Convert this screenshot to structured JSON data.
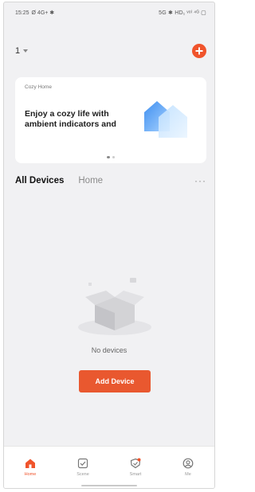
{
  "status_bar": {
    "time": "15:25",
    "left_indicators": "Ø 4G+ ✱",
    "right_indicators": "5G ✱ HD₁ ᵛᵒˡ ⁴ᴳ ▢"
  },
  "header": {
    "home_name": "1",
    "add_icon": "plus-icon"
  },
  "banner": {
    "tag": "Cozy Home",
    "headline": "Enjoy a cozy life with ambient indicators and",
    "page_count": 2,
    "active_page": 0
  },
  "tabs": [
    {
      "label": "All Devices",
      "active": true
    },
    {
      "label": "Home",
      "active": false
    }
  ],
  "more_label": "···",
  "empty_state": {
    "message": "No devices",
    "button_label": "Add Device"
  },
  "bottom_nav": [
    {
      "label": "Home",
      "icon": "home-icon",
      "active": true
    },
    {
      "label": "Scene",
      "icon": "scene-icon",
      "active": false
    },
    {
      "label": "Smart",
      "icon": "smart-icon",
      "active": false
    },
    {
      "label": "Me",
      "icon": "profile-icon",
      "active": false
    }
  ],
  "colors": {
    "accent": "#f0542c",
    "background": "#f1f1f3"
  }
}
